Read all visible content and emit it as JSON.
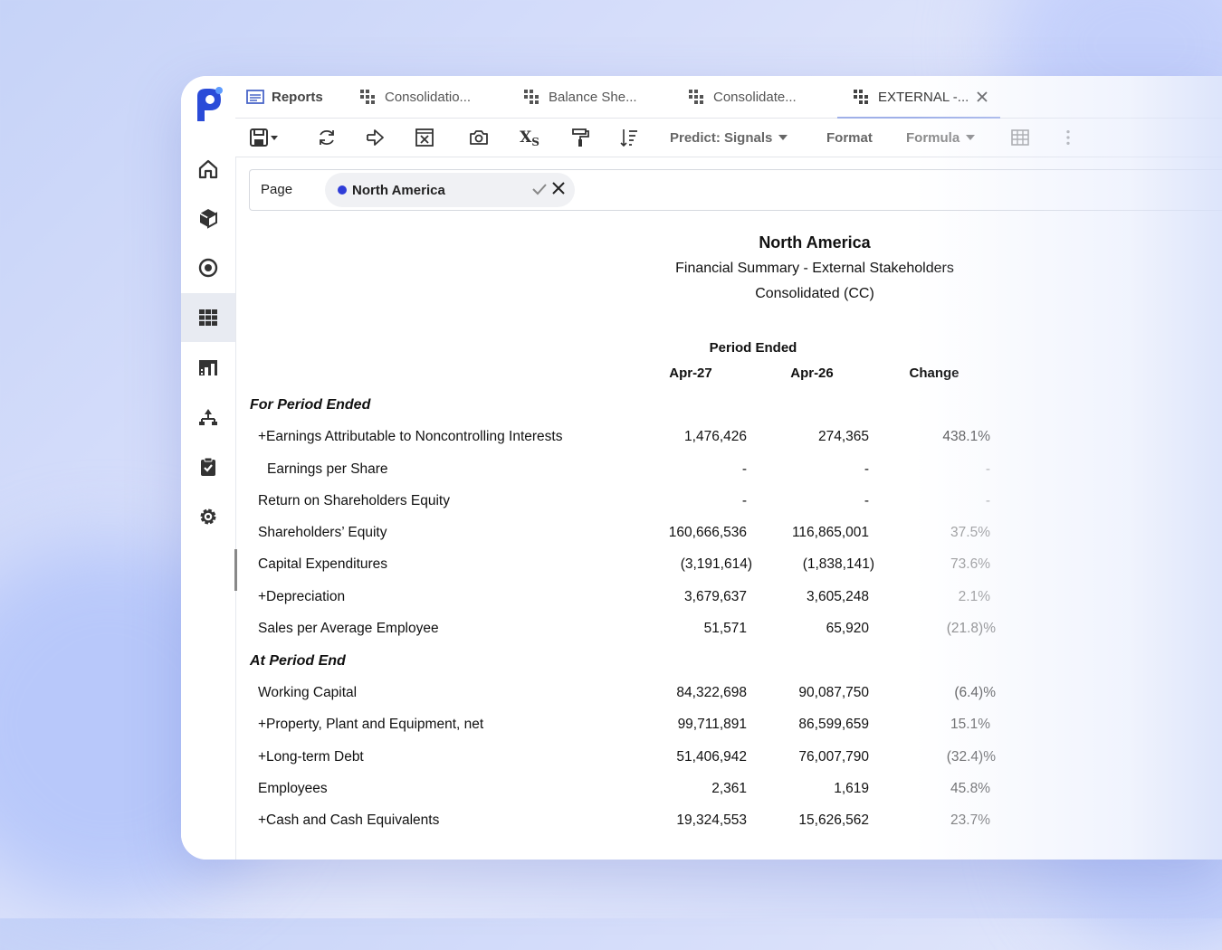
{
  "colors": {
    "accent": "#2f3dd8",
    "logo": "#2a4bd8",
    "tab_underline": "#9fb0e8"
  },
  "nav": {
    "items": [
      {
        "icon": "home-icon"
      },
      {
        "icon": "cube-icon"
      },
      {
        "icon": "target-icon"
      },
      {
        "icon": "grid-icon",
        "active": true
      },
      {
        "icon": "building-icon"
      },
      {
        "icon": "hierarchy-icon"
      },
      {
        "icon": "clipboard-check-icon"
      },
      {
        "icon": "gear-icon"
      }
    ]
  },
  "tabs": [
    {
      "label": "Reports"
    },
    {
      "label": "Consolidatio..."
    },
    {
      "label": "Balance She..."
    },
    {
      "label": "Consolidate..."
    },
    {
      "label": "EXTERNAL -..."
    }
  ],
  "toolbar": {
    "predict_label": "Predict: Signals",
    "format_label": "Format",
    "formula_label": "Formula",
    "subscript_label": "X",
    "subscript_sub": "S"
  },
  "pagebar": {
    "label": "Page",
    "selection": "North America"
  },
  "report": {
    "title": "North America",
    "subtitle": "Financial Summary - External Stakeholders",
    "subtitle2": "Consolidated (CC)",
    "period_header": "Period Ended",
    "col1": "Apr-27",
    "col2": "Apr-26",
    "col3": "Change",
    "section1": "For Period Ended",
    "section2": "At Period End",
    "rows1": [
      {
        "label": "+Earnings Attributable to Noncontrolling Interests",
        "v1": "1,476,426",
        "v2": "274,365",
        "v3": "438.1%"
      },
      {
        "label": "Earnings per Share",
        "v1": "-",
        "v2": "-",
        "v3": "-"
      },
      {
        "label": "Return on Shareholders Equity",
        "v1": "-",
        "v2": "-",
        "v3": "-"
      },
      {
        "label": "Shareholders’ Equity",
        "v1": "160,666,536",
        "v2": "116,865,001",
        "v3": "37.5%"
      },
      {
        "label": "Capital Expenditures",
        "v1": "(3,191,614)",
        "v2": "(1,838,141)",
        "v3": "73.6%"
      },
      {
        "label": "+Depreciation",
        "v1": "3,679,637",
        "v2": "3,605,248",
        "v3": "2.1%"
      },
      {
        "label": "Sales per Average Employee",
        "v1": "51,571",
        "v2": "65,920",
        "v3": "(21.8)%"
      }
    ],
    "rows2": [
      {
        "label": "Working Capital",
        "v1": "84,322,698",
        "v2": "90,087,750",
        "v3": "(6.4)%"
      },
      {
        "label": "+Property, Plant and Equipment, net",
        "v1": "99,711,891",
        "v2": "86,599,659",
        "v3": "15.1%"
      },
      {
        "label": "+Long-term Debt",
        "v1": "51,406,942",
        "v2": "76,007,790",
        "v3": "(32.4)%"
      },
      {
        "label": "Employees",
        "v1": "2,361",
        "v2": "1,619",
        "v3": "45.8%"
      },
      {
        "label": "+Cash and Cash Equivalents",
        "v1": "19,324,553",
        "v2": "15,626,562",
        "v3": "23.7%"
      }
    ]
  }
}
